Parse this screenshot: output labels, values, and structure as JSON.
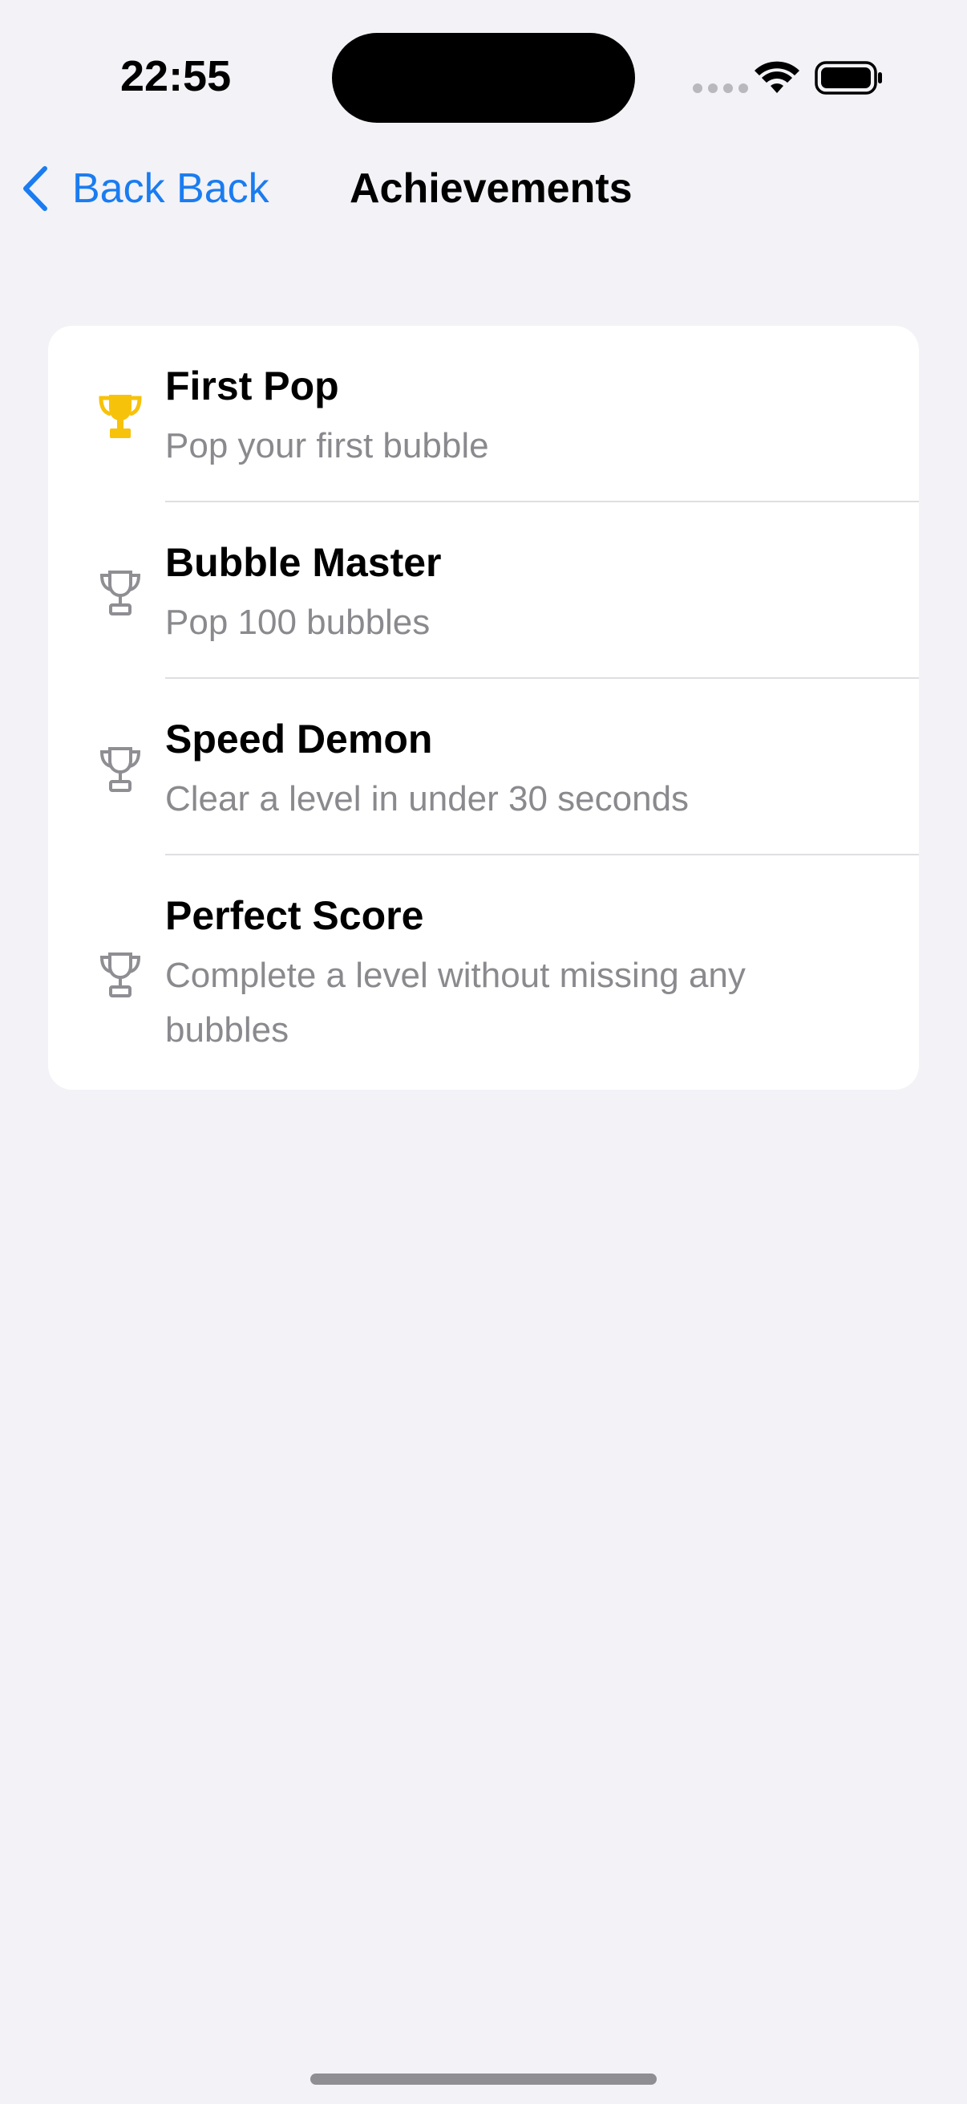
{
  "status_bar": {
    "time": "22:55"
  },
  "nav": {
    "back_label": "Back Back",
    "title": "Achievements"
  },
  "achievements": [
    {
      "title": "First Pop",
      "subtitle": "Pop your first bubble",
      "unlocked": true,
      "icon": "trophy-filled-icon"
    },
    {
      "title": "Bubble Master",
      "subtitle": "Pop 100 bubbles",
      "unlocked": false,
      "icon": "trophy-outline-icon"
    },
    {
      "title": "Speed Demon",
      "subtitle": "Clear a level in under 30 seconds",
      "unlocked": false,
      "icon": "trophy-outline-icon"
    },
    {
      "title": "Perfect Score",
      "subtitle": "Complete a level without missing any bubbles",
      "unlocked": false,
      "icon": "trophy-outline-icon"
    }
  ],
  "colors": {
    "background": "#f2f2f7",
    "accent": "#1a7cf0",
    "trophy_unlocked": "#f7c20a",
    "trophy_locked": "#8e8e93",
    "secondary_text": "#8a8a8e"
  }
}
